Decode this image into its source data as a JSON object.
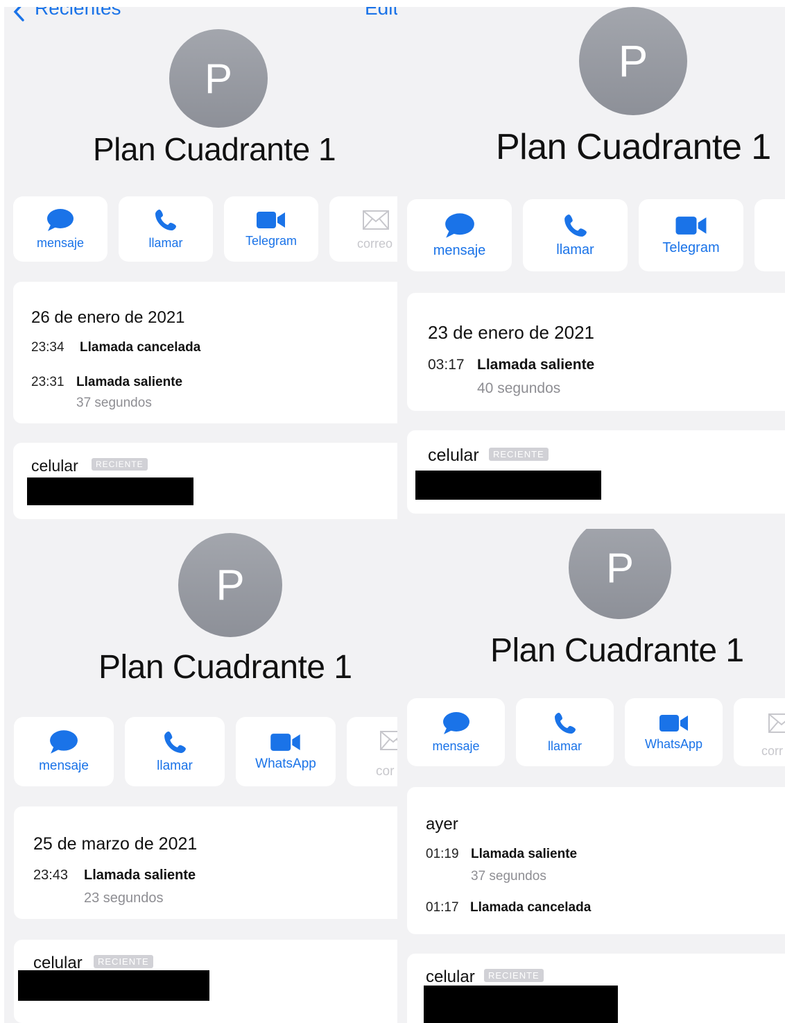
{
  "colors": {
    "accent": "#1a73e8",
    "avatar": "#9a9da4",
    "disabled": "#c7c7cc",
    "background": "#f2f2f4"
  },
  "nav": {
    "back_label": "Recientes",
    "edit_label": "Edit"
  },
  "contact": {
    "initial": "P",
    "name": "Plan Cuadrante 1"
  },
  "actions": {
    "message": "mensaje",
    "call": "llamar",
    "telegram": "Telegram",
    "whatsapp": "WhatsApp",
    "mail_full": "correo",
    "mail_partial_a": "cor",
    "mail_partial_b": "corr"
  },
  "phone": {
    "label": "celular",
    "badge": "RECIENTE"
  },
  "panels": [
    {
      "video_app": "Telegram",
      "date": "26 de enero de 2021",
      "calls": [
        {
          "time": "23:34",
          "type": "Llamada cancelada",
          "duration": ""
        },
        {
          "time": "23:31",
          "type": "Llamada saliente",
          "duration": "37 segundos"
        }
      ]
    },
    {
      "video_app": "Telegram",
      "date": "23 de enero de 2021",
      "calls": [
        {
          "time": "03:17",
          "type": "Llamada saliente",
          "duration": "40 segundos"
        }
      ]
    },
    {
      "video_app": "WhatsApp",
      "date": "25 de marzo de 2021",
      "calls": [
        {
          "time": "23:43",
          "type": "Llamada saliente",
          "duration": "23 segundos"
        }
      ]
    },
    {
      "video_app": "WhatsApp",
      "date": "ayer",
      "calls": [
        {
          "time": "01:19",
          "type": "Llamada saliente",
          "duration": "37 segundos"
        },
        {
          "time": "01:17",
          "type": "Llamada cancelada",
          "duration": ""
        }
      ]
    }
  ]
}
